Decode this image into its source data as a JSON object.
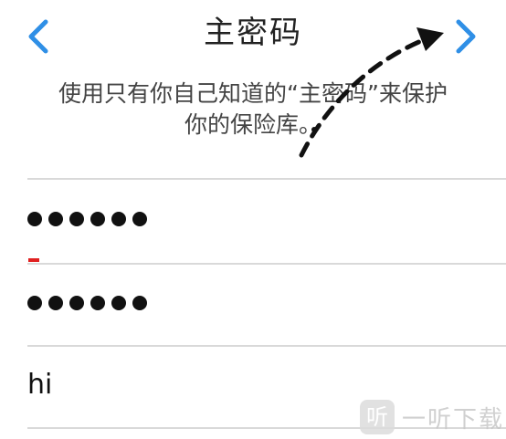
{
  "nav": {
    "title": "主密码",
    "back_icon": "chevron-left-icon",
    "next_icon": "chevron-right-icon",
    "accent_color": "#2f8fe6"
  },
  "description": {
    "line1": "使用只有你自己知道的“主密码”来保护",
    "line2": "你的保险库。"
  },
  "form": {
    "password": {
      "masked_value": "●●●●●●",
      "dot_count": 6
    },
    "confirm_password": {
      "masked_value": "●●●●●●",
      "dot_count": 6
    },
    "hint": {
      "value": "hi"
    }
  },
  "annotation": {
    "icon": "dashed-arrow-icon",
    "color": "#111111"
  },
  "watermark": {
    "logo_glyph": "听",
    "text": "一听下载"
  }
}
